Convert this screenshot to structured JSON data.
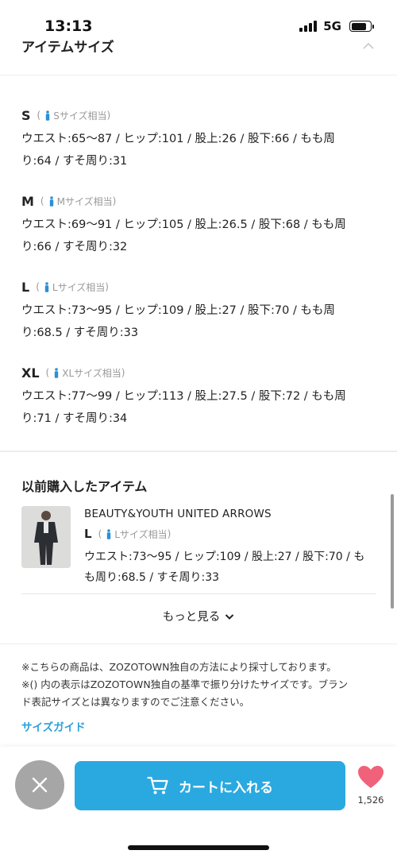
{
  "status": {
    "time": "13:13",
    "network": "5G"
  },
  "header": {
    "title": "アイテムサイズ"
  },
  "sizes": [
    {
      "name": "S",
      "hint": "Sサイズ相当",
      "measurements": [
        "ウエスト:65〜87 / ヒップ:101 / 股上:26 / 股下:66 / もも周",
        "り:64 / すそ周り:31"
      ]
    },
    {
      "name": "M",
      "hint": "Mサイズ相当",
      "measurements": [
        "ウエスト:69〜91 / ヒップ:105 / 股上:26.5 / 股下:68 / もも周",
        "り:66 / すそ周り:32"
      ]
    },
    {
      "name": "L",
      "hint": "Lサイズ相当",
      "measurements": [
        "ウエスト:73〜95 / ヒップ:109 / 股上:27 / 股下:70 / もも周",
        "り:68.5 / すそ周り:33"
      ]
    },
    {
      "name": "XL",
      "hint": "XLサイズ相当",
      "measurements": [
        "ウエスト:77〜99 / ヒップ:113 / 股上:27.5 / 股下:72 / もも周",
        "り:71 / すそ周り:34"
      ]
    }
  ],
  "previous": {
    "title": "以前購入したアイテム",
    "brand": "BEAUTY&YOUTH UNITED ARROWS",
    "size_name": "L",
    "size_hint": "Lサイズ相当",
    "measurements": [
      "ウエスト:73〜95 / ヒップ:109 / 股上:27 / 股下:70 / も",
      "も周り:68.5 / すそ周り:33"
    ],
    "more_label": "もっと見る"
  },
  "notes": {
    "line1": "※こちらの商品は、ZOZOTOWN独自の方法により採寸しております。",
    "line2a": "※() 内の表示はZOZOTOWN独自の基準で振り分けたサイズです。ブラン",
    "line2b": "ド表記サイズとは異なりますのでご注意ください。",
    "guide_label": "サイズガイド"
  },
  "bottom": {
    "cart_label": "カートに入れる",
    "fav_count": "1,526"
  },
  "colors": {
    "accent": "#2aa9e0",
    "link": "#2aa0d8",
    "heart": "#f0627a",
    "close": "#a6a6a6"
  }
}
